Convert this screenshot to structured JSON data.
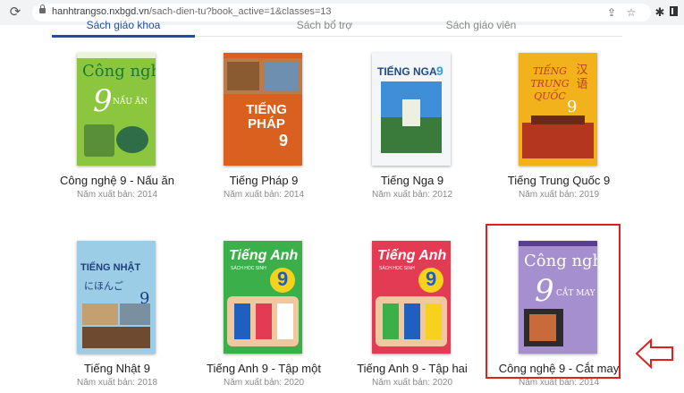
{
  "browser": {
    "url_host": "hanhtrangso.nxbgd.vn",
    "url_path": "/sach-dien-tu?book_active=1&classes=13",
    "reload_icon": "reload-icon",
    "lock_icon": "lock-icon",
    "share_icon": "share-icon",
    "star_icon": "star-icon",
    "extensions_icon": "extensions-icon",
    "panel_icon": "side-panel-icon"
  },
  "tabs": [
    {
      "label": "Sách giáo khoa",
      "active": true
    },
    {
      "label": "Sách bổ trợ",
      "active": false
    },
    {
      "label": "Sách giáo viên",
      "active": false
    }
  ],
  "books": [
    {
      "title": "Công nghệ 9 - Nấu ăn",
      "year": "Năm xuất bản: 2014",
      "cover_text": "Công nghệ",
      "cover_num": "9",
      "cover_sub": "NẤU ĂN",
      "colors": [
        "#8cc63f",
        "#ffffff",
        "#1a7a2e"
      ]
    },
    {
      "title": "Tiếng Pháp 9",
      "year": "Năm xuất bản: 2014",
      "cover_text": "TIẾNG PHÁP",
      "cover_num": "9",
      "cover_sub": "",
      "colors": [
        "#d9601f",
        "#ffffff",
        "#8a3a10"
      ]
    },
    {
      "title": "Tiếng Nga 9",
      "year": "Năm xuất bản: 2012",
      "cover_text": "TIẾNG NGA",
      "cover_num": "9",
      "cover_sub": "",
      "colors": [
        "#f4f6fa",
        "#1f4a8c",
        "#3f8fd8"
      ]
    },
    {
      "title": "Tiếng Trung Quốc 9",
      "year": "Năm xuất bản: 2019",
      "cover_text": "TIẾNG TRUNG QUỐC",
      "cover_num": "9",
      "cover_sub": "汉语",
      "colors": [
        "#f2b21c",
        "#c0392b",
        "#ffffff"
      ]
    },
    {
      "title": "Tiếng Nhật 9",
      "year": "Năm xuất bản: 2018",
      "cover_text": "TIẾNG NHẬT",
      "cover_num": "9",
      "cover_sub": "にほんご",
      "colors": [
        "#9ccde6",
        "#1e3f7a",
        "#ffffff"
      ]
    },
    {
      "title": "Tiếng Anh 9 - Tập một",
      "year": "Năm xuất bản: 2020",
      "cover_text": "Tiếng Anh",
      "cover_num": "9",
      "cover_sub": "SÁCH HỌC SINH",
      "colors": [
        "#3bb04a",
        "#1f5fbf",
        "#ffffff"
      ]
    },
    {
      "title": "Tiếng Anh 9 - Tập hai",
      "year": "Năm xuất bản: 2020",
      "cover_text": "Tiếng Anh",
      "cover_num": "9",
      "cover_sub": "SÁCH HỌC SINH",
      "colors": [
        "#e23b53",
        "#1f5fbf",
        "#ffffff"
      ]
    },
    {
      "title": "Công nghệ 9 - Cắt may",
      "year": "Năm xuất bản: 2014",
      "cover_text": "Công nghệ",
      "cover_num": "9",
      "cover_sub": "CẮT MAY",
      "colors": [
        "#a58fcf",
        "#ffffff",
        "#5b3d8f"
      ]
    }
  ],
  "annotation": {
    "highlight_color": "#e02020",
    "arrow_icon": "left-arrow-icon"
  }
}
